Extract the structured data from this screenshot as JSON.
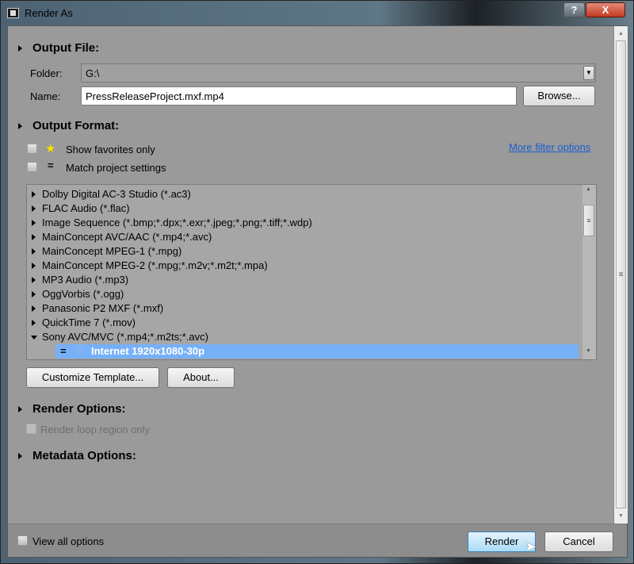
{
  "window": {
    "title": "Render As",
    "help_label": "?",
    "close_label": "X"
  },
  "output_file": {
    "header": "Output File:",
    "folder_label": "Folder:",
    "folder_value": "G:\\",
    "name_label": "Name:",
    "name_value": "PressReleaseProject.mxf.mp4",
    "browse_label": "Browse..."
  },
  "output_format": {
    "header": "Output Format:",
    "show_favorites_label": "Show favorites only",
    "match_project_label": "Match project settings",
    "match_symbol": "=",
    "more_filter_label": "More filter options",
    "formats": [
      {
        "label": "Dolby Digital AC-3 Studio (*.ac3)",
        "expanded": false
      },
      {
        "label": "FLAC Audio (*.flac)",
        "expanded": false
      },
      {
        "label": "Image Sequence (*.bmp;*.dpx;*.exr;*.jpeg;*.png;*.tiff;*.wdp)",
        "expanded": false
      },
      {
        "label": "MainConcept AVC/AAC (*.mp4;*.avc)",
        "expanded": false
      },
      {
        "label": "MainConcept MPEG-1 (*.mpg)",
        "expanded": false
      },
      {
        "label": "MainConcept MPEG-2 (*.mpg;*.m2v;*.m2t;*.mpa)",
        "expanded": false
      },
      {
        "label": "MP3 Audio (*.mp3)",
        "expanded": false
      },
      {
        "label": "OggVorbis (*.ogg)",
        "expanded": false
      },
      {
        "label": "Panasonic P2 MXF (*.mxf)",
        "expanded": false
      },
      {
        "label": "QuickTime 7 (*.mov)",
        "expanded": false
      },
      {
        "label": "Sony AVC/MVC (*.mp4;*.m2ts;*.avc)",
        "expanded": true
      }
    ],
    "selected_template": {
      "label": "Internet 1920x1080-30p",
      "match_symbol": "="
    },
    "customize_label": "Customize Template...",
    "about_label": "About..."
  },
  "render_options": {
    "header": "Render Options:",
    "loop_region_label": "Render loop region only"
  },
  "metadata_options": {
    "header": "Metadata Options:"
  },
  "footer": {
    "view_all_label": "View all options",
    "render_label": "Render",
    "cancel_label": "Cancel"
  },
  "colors": {
    "selection": "#77b0f7",
    "link": "#1a5fd0",
    "background": "#9a9a9a"
  }
}
